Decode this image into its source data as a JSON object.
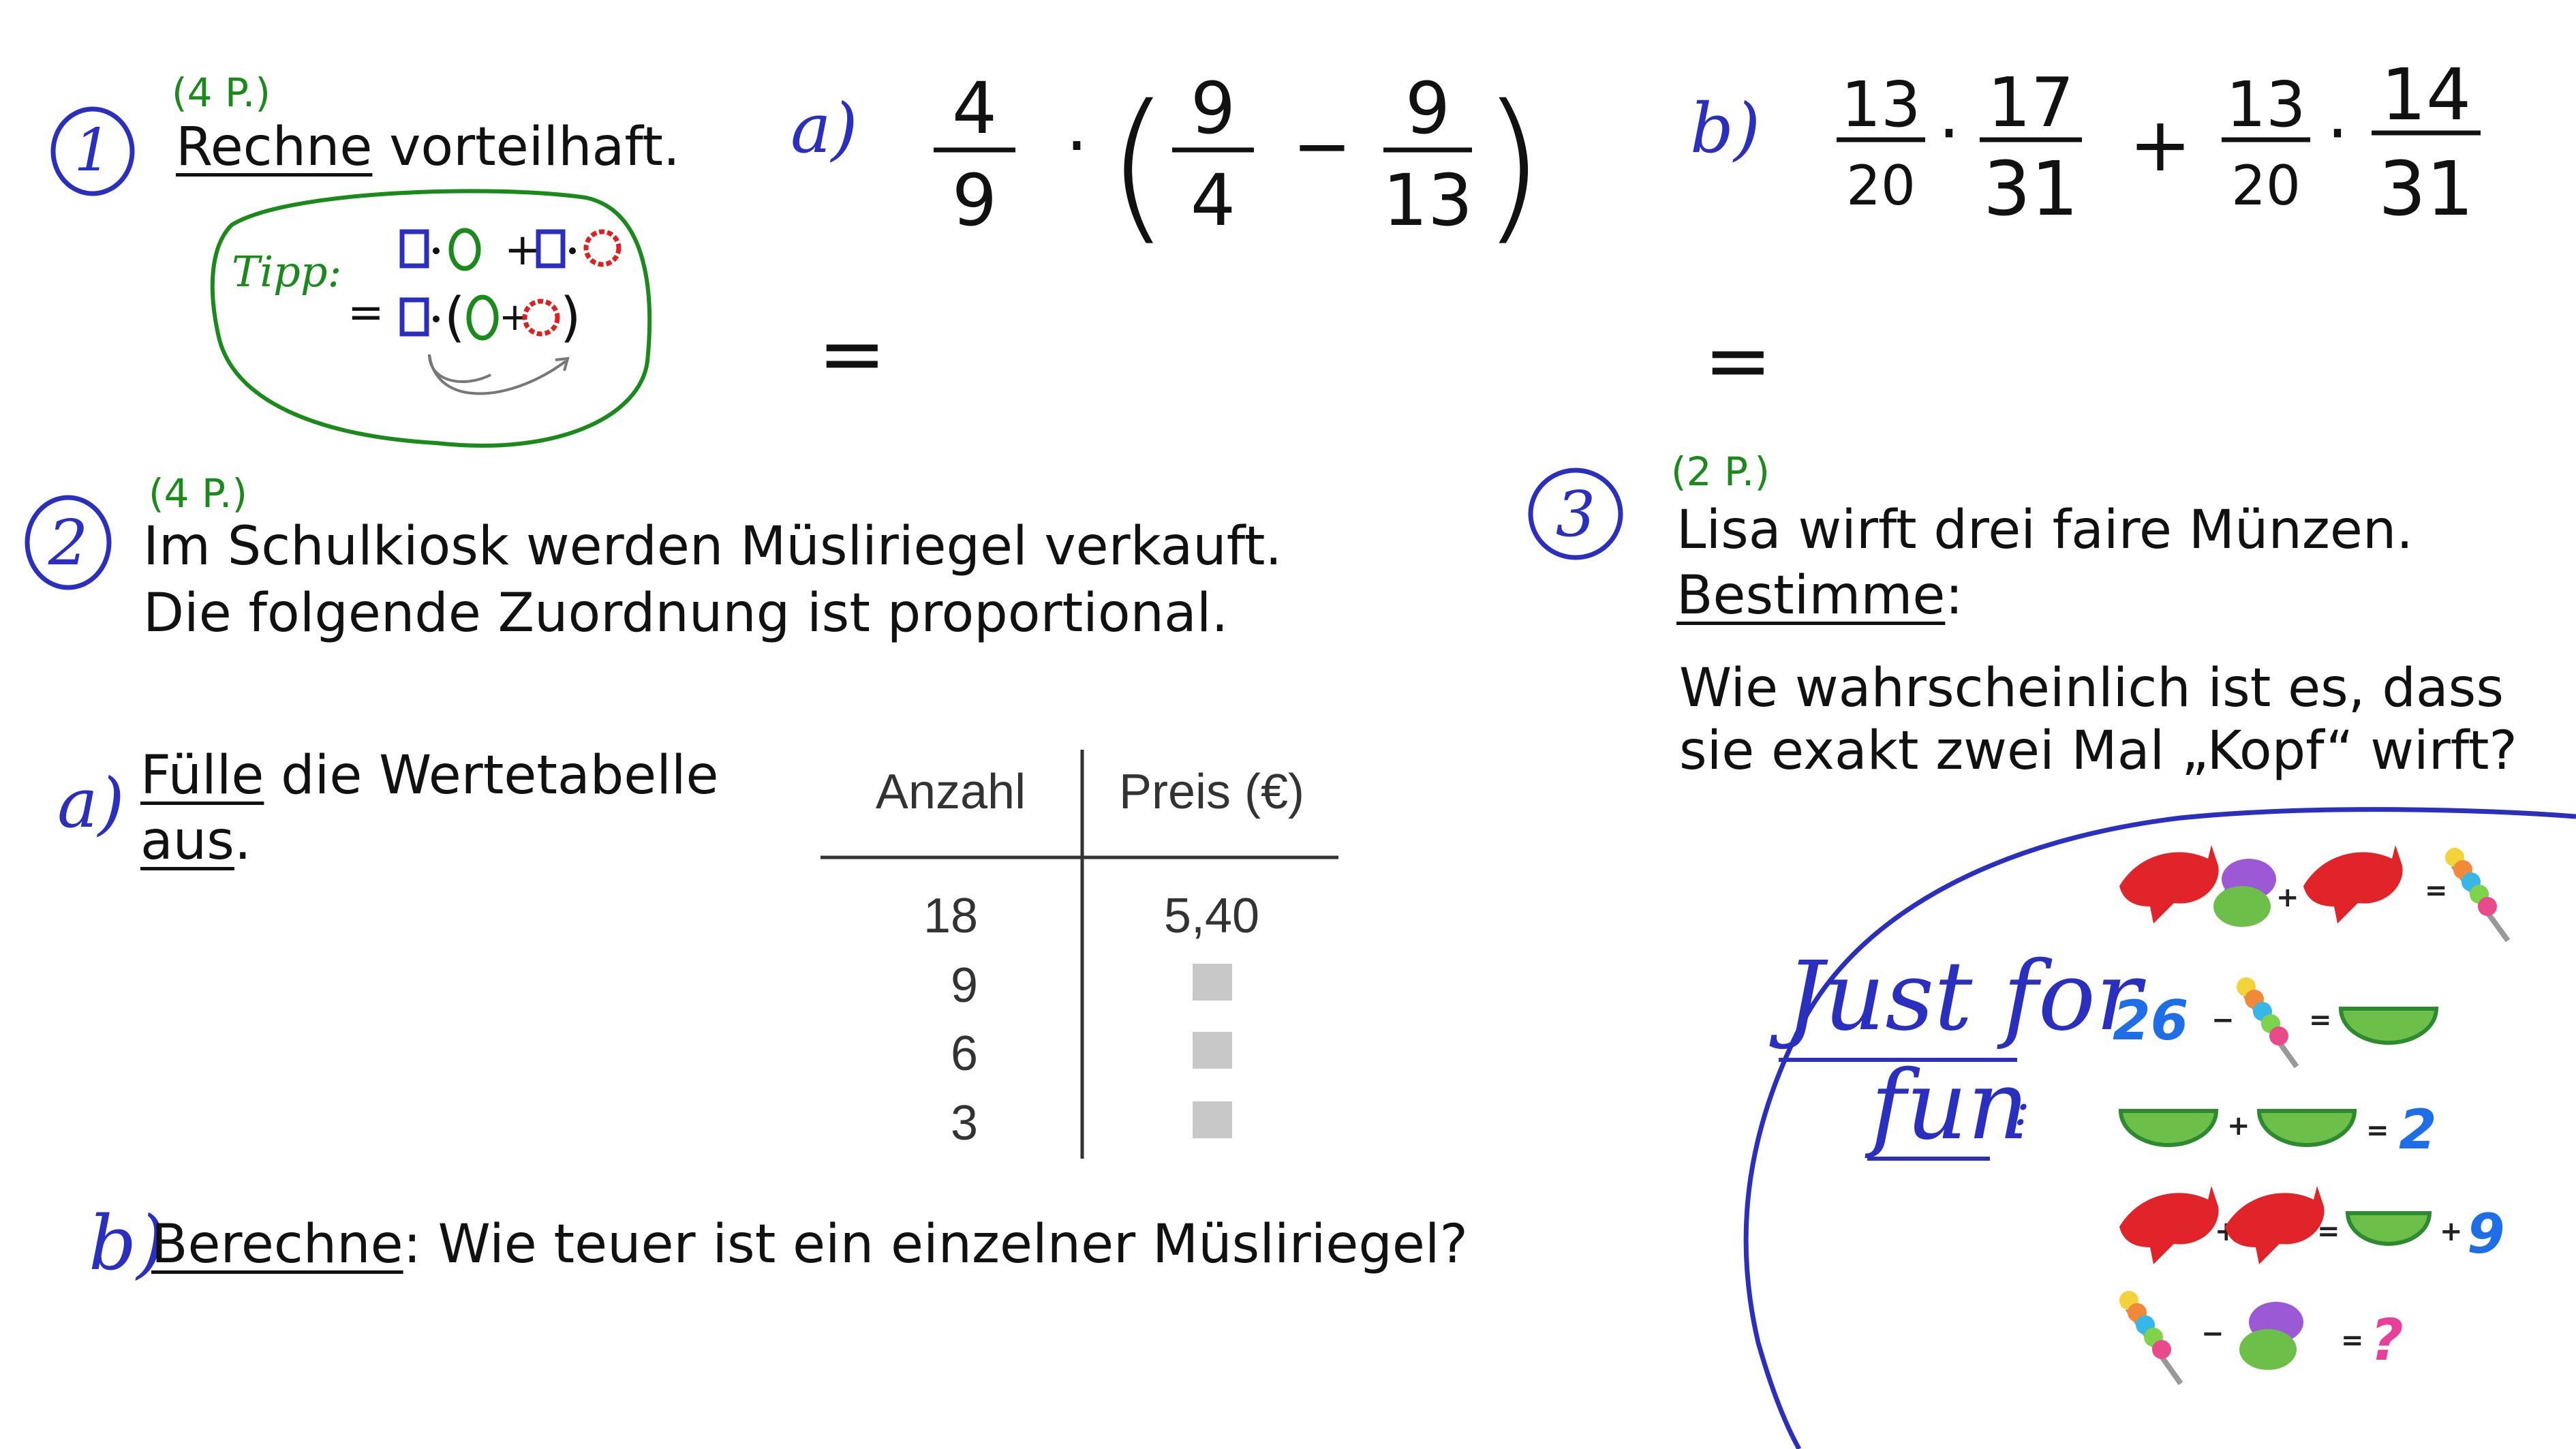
{
  "task1": {
    "number": "1",
    "points": "(4 P.)",
    "instruction_verb": "Rechne",
    "instruction_rest": " vorteilhaft.",
    "tip": {
      "label": "Tipp:",
      "line1_plus": "+",
      "line2_eq": "="
    },
    "a": {
      "label": "a)",
      "f1_num": "4",
      "f1_den": "9",
      "f2_num": "9",
      "f2_den": "4",
      "f3_num": "9",
      "f3_den": "13",
      "op_mul": "·",
      "op_minus": "−",
      "equals": "="
    },
    "b": {
      "label": "b)",
      "f1_num": "13",
      "f1_den": "20",
      "f2_num": "17",
      "f2_den": "31",
      "f3_num": "13",
      "f3_den": "20",
      "f4_num": "14",
      "f4_den": "31",
      "op_mul": "·",
      "op_plus": "+",
      "equals": "="
    }
  },
  "task2": {
    "number": "2",
    "points": "(4 P.)",
    "line1": "Im Schulkiosk werden Müsliriegel verkauft.",
    "line2": "Die folgende Zuordnung ist proportional.",
    "a": {
      "label": "a)",
      "verb": "Fülle",
      "text1": " die Wertetabelle",
      "text2": "aus",
      "text2_end": "."
    },
    "table": {
      "headers": [
        "Anzahl",
        "Preis (€)"
      ],
      "rows": [
        {
          "anzahl": "18",
          "preis": "5,40"
        },
        {
          "anzahl": "9",
          "preis": ""
        },
        {
          "anzahl": "6",
          "preis": ""
        },
        {
          "anzahl": "3",
          "preis": ""
        }
      ]
    },
    "b": {
      "label": "b)",
      "verb": "Berechne",
      "rest": ": Wie teuer ist ein einzelner Müsliriegel?"
    }
  },
  "task3": {
    "number": "3",
    "points": "(2 P.)",
    "line1": "Lisa wirft drei faire Münzen.",
    "verb": "Bestimme",
    "verb_end": ":",
    "q1": "Wie wahrscheinlich ist es, dass",
    "q2": "sie exakt zwei Mal „Kopf“ wirft?"
  },
  "fun": {
    "line1": "Just for",
    "line2": "fun",
    "colon": ":",
    "eq1": {
      "op1": "+",
      "op2": "+",
      "eq": "="
    },
    "eq2": {
      "num": "26",
      "op": "−",
      "eq": "="
    },
    "eq3": {
      "op": "+",
      "eq": "=",
      "result": "2"
    },
    "eq4": {
      "op1": "+",
      "eq": "=",
      "op2": "+",
      "result": "9"
    },
    "eq5": {
      "op": "−",
      "eq": "=",
      "result": "?"
    }
  }
}
